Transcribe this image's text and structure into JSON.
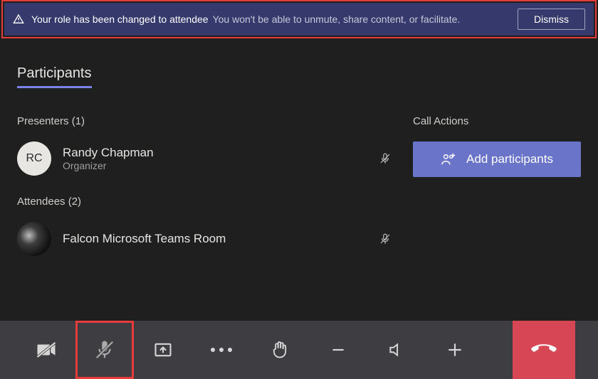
{
  "notification": {
    "title": "Your role has been changed to attendee",
    "text": "You won't be able to unmute, share content, or facilitate.",
    "dismiss_label": "Dismiss"
  },
  "section_title": "Participants",
  "presenters": {
    "label": "Presenters (1)",
    "items": [
      {
        "initials": "RC",
        "name": "Randy Chapman",
        "role": "Organizer",
        "mic_muted": true
      }
    ]
  },
  "attendees": {
    "label": "Attendees (2)",
    "items": [
      {
        "initials": "",
        "name": "Falcon Microsoft Teams Room",
        "role": "",
        "mic_muted": true
      }
    ]
  },
  "call_actions": {
    "label": "Call Actions",
    "add_participants_label": "Add participants"
  },
  "footer": {
    "camera_off": true,
    "mic_off_highlighted": true
  }
}
